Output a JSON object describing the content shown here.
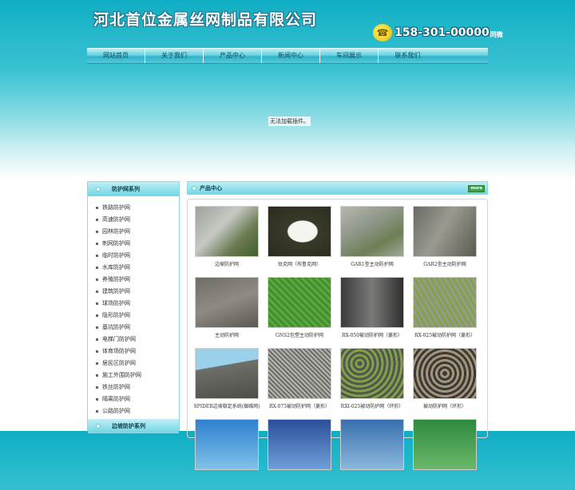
{
  "header": {
    "company_name": "河北首位金属丝网制品有限公司",
    "phone": "158-301-00000",
    "phone_suffix": "同微",
    "phone_icon": "phone-icon"
  },
  "nav": {
    "items": [
      "网站首页",
      "关于我们",
      "产品中心",
      "新闻中心",
      "车间展示",
      "联系我们"
    ]
  },
  "banner": {
    "plugin_message": "无法加载插件。"
  },
  "sidebar": {
    "title": "防护网系列",
    "items": [
      "铁路防护网",
      "高速防护网",
      "园林防护网",
      "刺网防护网",
      "临时防护网",
      "水库防护网",
      "养殖防护网",
      "建筑防护网",
      "球场防护网",
      "隐形防护网",
      "基坑防护网",
      "电梯门防护网",
      "体育场防护网",
      "居民区防护网",
      "施工外围防护网",
      "铁丝防护网",
      "隔离防护网",
      "公路防护网"
    ],
    "title2": "边坡防护系列"
  },
  "main": {
    "title": "产品中心",
    "more_label": "more",
    "products": [
      {
        "caption": "边坡防护网"
      },
      {
        "caption": "钛克网（布鲁克网）"
      },
      {
        "caption": "GAR1型主动防护网"
      },
      {
        "caption": "GAR2型主动防护网"
      },
      {
        "caption": "主动防护网"
      },
      {
        "caption": "GNS2包塑主动防护网"
      },
      {
        "caption": "RX-050被动防护网（菱形）"
      },
      {
        "caption": "RX-025被动防护网（菱形）"
      },
      {
        "caption": "SPIDER边坡稳定系统(蜘蛛网)"
      },
      {
        "caption": "RX-075被动防护网（菱形）"
      },
      {
        "caption": "RXI-025被动防护网（环形）"
      },
      {
        "caption": "被动防护网（环形）"
      },
      {
        "caption": ""
      },
      {
        "caption": ""
      },
      {
        "caption": ""
      },
      {
        "caption": ""
      }
    ]
  }
}
